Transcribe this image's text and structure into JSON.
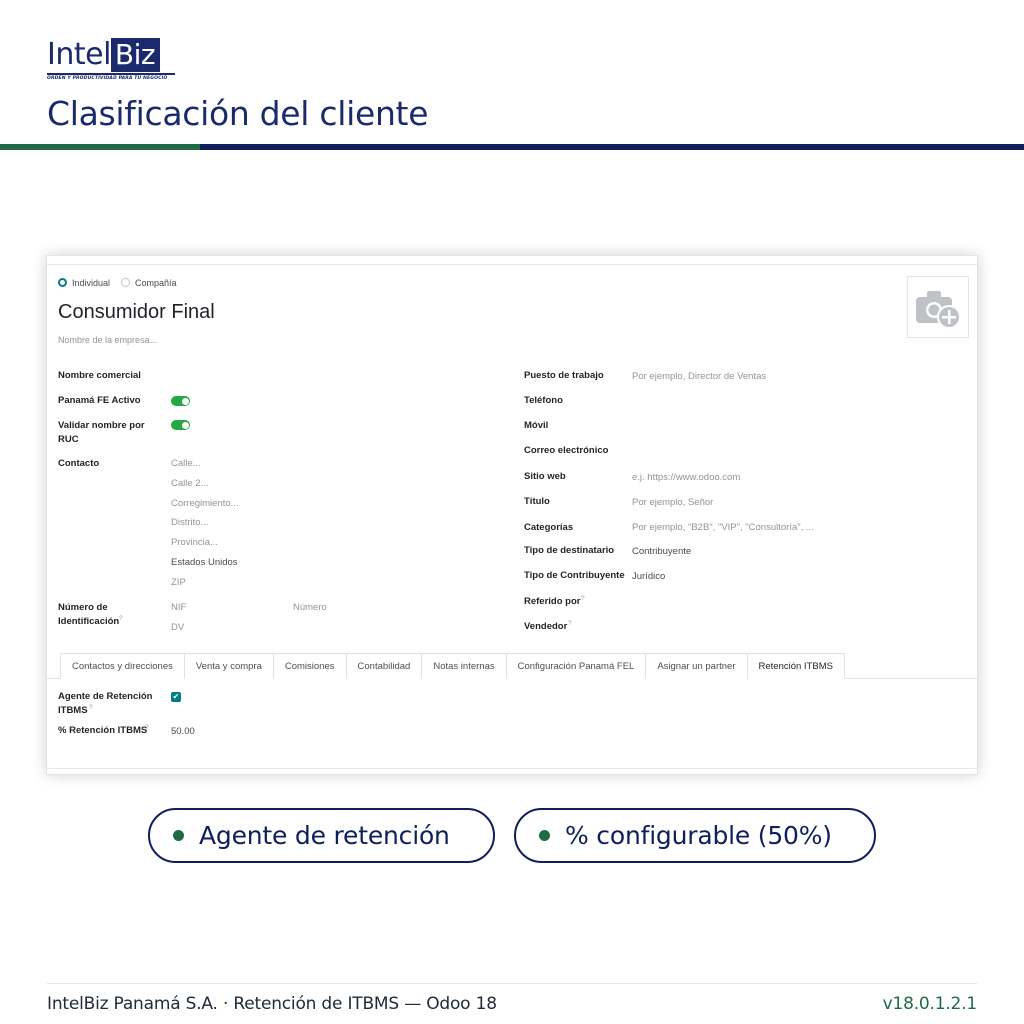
{
  "brand": {
    "logo_left": "Intel",
    "logo_right": "Biz",
    "tagline": "ORDEN Y PRODUCTIVIDAD PARA TU NEGOCIO",
    "navy": "#0f1f5c",
    "green": "#1f6b45"
  },
  "page": {
    "title": "Clasificación del cliente"
  },
  "form": {
    "type_individual": "Individual",
    "type_company": "Compañía",
    "selected_type": "Individual",
    "name": "Consumidor Final",
    "company_placeholder": "Nombre de la empresa...",
    "photo_icon": "camera-plus-icon",
    "left": {
      "nombre_comercial_label": "Nombre comercial",
      "fe_activo_label": "Panamá FE Activo",
      "fe_activo_on": true,
      "validar_label_1": "Validar nombre por",
      "validar_label_2": "RUC",
      "validar_on": true,
      "contacto_label": "Contacto",
      "calle": "Calle...",
      "calle2": "Calle 2...",
      "corregimiento": "Corregimiento...",
      "distrito": "Distrito...",
      "provincia": "Provincia...",
      "pais": "Estados Unidos",
      "zip": "ZIP",
      "numero_ident_label_1": "Número de",
      "numero_ident_label_2": "Identificación",
      "help_mark": "?",
      "nif": "NIF",
      "numero": "Número",
      "dv": "DV"
    },
    "right": {
      "puesto_label": "Puesto de trabajo",
      "puesto_placeholder": "Por ejemplo, Director de Ventas",
      "telefono_label": "Teléfono",
      "movil_label": "Móvil",
      "correo_label": "Correo electrónico",
      "sitio_label": "Sitio web",
      "sitio_placeholder": "e.j. https://www.odoo.com",
      "titulo_label": "Título",
      "titulo_placeholder": "Por ejemplo, Señor",
      "categorias_label": "Categorías",
      "categorias_placeholder": "Por ejemplo, \"B2B\", \"VIP\", \"Consultoría\", ...",
      "tipo_dest_label": "Tipo de destinatario",
      "tipo_dest_value": "Contribuyente",
      "tipo_contrib_label": "Tipo de Contribuyente",
      "tipo_contrib_value": "Jurídico",
      "referido_label": "Referido por",
      "vendedor_label": "Vendedor"
    },
    "tabs": [
      {
        "label": "Contactos y direcciones"
      },
      {
        "label": "Venta y compra"
      },
      {
        "label": "Comisiones"
      },
      {
        "label": "Contabilidad"
      },
      {
        "label": "Notas internas"
      },
      {
        "label": "Configuración Panamá FEL"
      },
      {
        "label": "Asignar un partner"
      },
      {
        "label": "Retención ITBMS"
      }
    ],
    "active_tab": "Retención ITBMS",
    "retencion": {
      "agente_label_1": "Agente de Retención",
      "agente_label_2": "ITBMS",
      "agente_checked": true,
      "check_glyph": "✔",
      "porcentaje_label": "% Retención ITBMS",
      "porcentaje_value": "50.00"
    }
  },
  "pills": [
    {
      "text": "Agente de retención"
    },
    {
      "text": "% configurable (50%)"
    }
  ],
  "footer": {
    "left": "IntelBiz Panamá S.A. · Retención de ITBMS — Odoo 18",
    "right": "v18.0.1.2.1"
  }
}
